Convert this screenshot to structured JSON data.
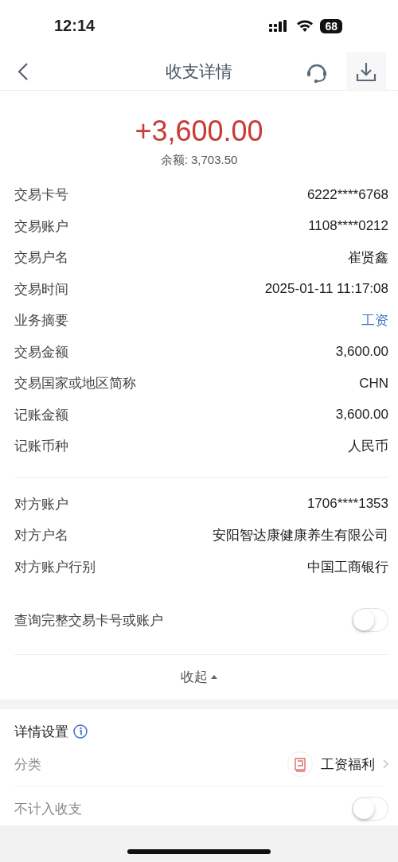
{
  "status_bar": {
    "time": "12:14",
    "battery": "68"
  },
  "header": {
    "title": "收支详情"
  },
  "amount": "+3,600.00",
  "balance": "余额: 3,703.50",
  "details": [
    {
      "label": "交易卡号",
      "value": "6222****6768",
      "kind": "text"
    },
    {
      "label": "交易账户",
      "value": "1108****0212",
      "kind": "text"
    },
    {
      "label": "交易户名",
      "value": "崔贤鑫",
      "kind": "text"
    },
    {
      "label": "交易时间",
      "value": "2025-01-11 11:17:08",
      "kind": "text"
    },
    {
      "label": "业务摘要",
      "value": "工资",
      "kind": "link"
    },
    {
      "label": "交易金额",
      "value": "3,600.00",
      "kind": "text"
    },
    {
      "label": "交易国家或地区简称",
      "value": "CHN",
      "kind": "text"
    },
    {
      "label": "记账金额",
      "value": "3,600.00",
      "kind": "text"
    },
    {
      "label": "记账币种",
      "value": "人民币",
      "kind": "text"
    }
  ],
  "counterparty": [
    {
      "label": "对方账户",
      "value": "1706****1353"
    },
    {
      "label": "对方户名",
      "value": "安阳智达康健康养生有限公司"
    },
    {
      "label": "对方账户行别",
      "value": "中国工商银行"
    }
  ],
  "full_number_toggle": {
    "label": "查询完整交易卡号或账户",
    "on": false
  },
  "collapse": "收起",
  "settings": {
    "title": "详情设置",
    "category_label": "分类",
    "category": "工资福利",
    "exclude": {
      "label": "不计入收支",
      "on": false
    }
  }
}
